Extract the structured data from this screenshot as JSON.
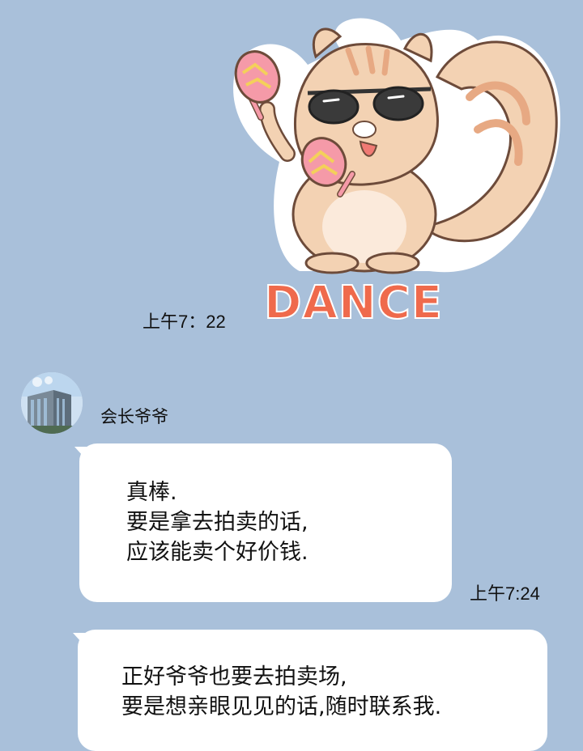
{
  "messages": [
    {
      "type": "sticker",
      "sticker_text": "DANCE",
      "icon": "squirrel-sunglasses-maracas-sticker",
      "time": "上午7：22"
    },
    {
      "type": "text",
      "sender": "会长爷爷",
      "avatar_icon": "building-avatar",
      "lines": [
        "真棒.",
        "要是拿去拍卖的话,",
        "应该能卖个好价钱."
      ],
      "time": "上午7:24"
    },
    {
      "type": "text",
      "lines": [
        "正好爷爷也要去拍卖场,",
        "要是想亲眼见见的话,随时联系我."
      ]
    }
  ],
  "colors": {
    "background": "#a9c0da",
    "bubble": "#ffffff",
    "sticker_text": "#ef6a4c",
    "squirrel_body": "#f3d2b3"
  }
}
